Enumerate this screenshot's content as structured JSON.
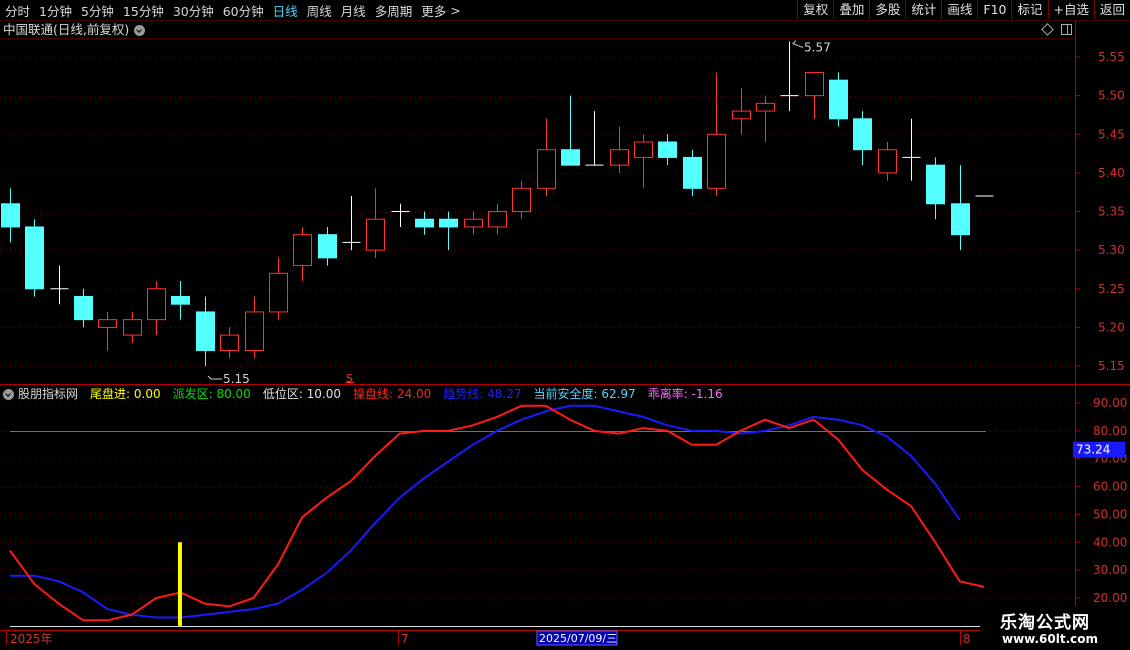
{
  "toolbar": {
    "periods": [
      {
        "label": "分时",
        "active": false
      },
      {
        "label": "1分钟",
        "active": false
      },
      {
        "label": "5分钟",
        "active": false
      },
      {
        "label": "15分钟",
        "active": false
      },
      {
        "label": "30分钟",
        "active": false
      },
      {
        "label": "60分钟",
        "active": false
      },
      {
        "label": "日线",
        "active": true
      },
      {
        "label": "周线",
        "active": false
      },
      {
        "label": "月线",
        "active": false
      },
      {
        "label": "多周期",
        "active": false
      },
      {
        "label": "更多",
        "active": false
      }
    ],
    "more_arrow": ">",
    "right_buttons": [
      "复权",
      "叠加",
      "多股",
      "统计",
      "画线",
      "F10",
      "标记",
      "+自选",
      "返回"
    ]
  },
  "stock_title": "中国联通(日线,前复权)",
  "price_axis": [
    "5.55",
    "5.50",
    "5.45",
    "5.40",
    "5.35",
    "5.30",
    "5.25",
    "5.20",
    "5.15"
  ],
  "annotations": {
    "high": "5.57",
    "low": "5.15",
    "marker": "S"
  },
  "indicator": {
    "name": "股朋指标网",
    "items": [
      {
        "label": "尾盘进: 0.00",
        "color": "#ffff00"
      },
      {
        "label": "派发区: 80.00",
        "color": "#00e000"
      },
      {
        "label": "低位区: 10.00",
        "color": "#e0e0e0"
      },
      {
        "label": "操盘线: 24.00",
        "color": "#ff2020"
      },
      {
        "label": "趋势线: 48.27",
        "color": "#2020ff"
      },
      {
        "label": "当前安全度: 62.97",
        "color": "#4fd3ff"
      },
      {
        "label": "乖离率: -1.16",
        "color": "#ff66ff"
      }
    ],
    "axis": [
      "90.00",
      "80.00",
      "70.00",
      "60.00",
      "50.00",
      "40.00",
      "30.00",
      "20.00"
    ],
    "current_value": "73.24"
  },
  "date_axis": {
    "start": "2025年",
    "m7": "7",
    "cursor": "2025/07/09/三",
    "m8": "8"
  },
  "watermark": {
    "line1": "乐淘公式网",
    "line2": "www.60lt.com"
  },
  "colors": {
    "up": "#ff3232",
    "down": "#54ffff",
    "bg": "#000000",
    "frame": "#b00000"
  },
  "chart_data": {
    "type": "candlestick",
    "price_range": [
      5.14,
      5.57
    ],
    "candles": [
      {
        "o": 5.36,
        "c": 5.33,
        "h": 5.38,
        "l": 5.31
      },
      {
        "o": 5.33,
        "c": 5.25,
        "h": 5.34,
        "l": 5.24
      },
      {
        "o": 5.25,
        "c": 5.25,
        "h": 5.28,
        "l": 5.23
      },
      {
        "o": 5.24,
        "c": 5.21,
        "h": 5.25,
        "l": 5.2
      },
      {
        "o": 5.2,
        "c": 5.21,
        "h": 5.22,
        "l": 5.17
      },
      {
        "o": 5.19,
        "c": 5.21,
        "h": 5.22,
        "l": 5.18
      },
      {
        "o": 5.21,
        "c": 5.25,
        "h": 5.26,
        "l": 5.19
      },
      {
        "o": 5.24,
        "c": 5.23,
        "h": 5.26,
        "l": 5.21
      },
      {
        "o": 5.22,
        "c": 5.17,
        "h": 5.24,
        "l": 5.15
      },
      {
        "o": 5.17,
        "c": 5.19,
        "h": 5.2,
        "l": 5.16
      },
      {
        "o": 5.17,
        "c": 5.22,
        "h": 5.24,
        "l": 5.16
      },
      {
        "o": 5.22,
        "c": 5.27,
        "h": 5.29,
        "l": 5.21
      },
      {
        "o": 5.28,
        "c": 5.32,
        "h": 5.33,
        "l": 5.26
      },
      {
        "o": 5.32,
        "c": 5.29,
        "h": 5.33,
        "l": 5.28
      },
      {
        "o": 5.31,
        "c": 5.31,
        "h": 5.37,
        "l": 5.3
      },
      {
        "o": 5.3,
        "c": 5.34,
        "h": 5.38,
        "l": 5.29
      },
      {
        "o": 5.35,
        "c": 5.35,
        "h": 5.36,
        "l": 5.33
      },
      {
        "o": 5.34,
        "c": 5.33,
        "h": 5.35,
        "l": 5.32
      },
      {
        "o": 5.34,
        "c": 5.33,
        "h": 5.35,
        "l": 5.3
      },
      {
        "o": 5.33,
        "c": 5.34,
        "h": 5.35,
        "l": 5.32
      },
      {
        "o": 5.33,
        "c": 5.35,
        "h": 5.36,
        "l": 5.32
      },
      {
        "o": 5.35,
        "c": 5.38,
        "h": 5.39,
        "l": 5.34
      },
      {
        "o": 5.38,
        "c": 5.43,
        "h": 5.47,
        "l": 5.37
      },
      {
        "o": 5.43,
        "c": 5.41,
        "h": 5.5,
        "l": 5.41
      },
      {
        "o": 5.41,
        "c": 5.41,
        "h": 5.48,
        "l": 5.41
      },
      {
        "o": 5.41,
        "c": 5.43,
        "h": 5.46,
        "l": 5.4
      },
      {
        "o": 5.42,
        "c": 5.44,
        "h": 5.45,
        "l": 5.38
      },
      {
        "o": 5.44,
        "c": 5.42,
        "h": 5.45,
        "l": 5.41
      },
      {
        "o": 5.42,
        "c": 5.38,
        "h": 5.43,
        "l": 5.37
      },
      {
        "o": 5.38,
        "c": 5.45,
        "h": 5.53,
        "l": 5.37
      },
      {
        "o": 5.47,
        "c": 5.48,
        "h": 5.51,
        "l": 5.45
      },
      {
        "o": 5.48,
        "c": 5.49,
        "h": 5.5,
        "l": 5.44
      },
      {
        "o": 5.5,
        "c": 5.5,
        "h": 5.57,
        "l": 5.48
      },
      {
        "o": 5.5,
        "c": 5.53,
        "h": 5.53,
        "l": 5.47
      },
      {
        "o": 5.52,
        "c": 5.47,
        "h": 5.53,
        "l": 5.46
      },
      {
        "o": 5.47,
        "c": 5.43,
        "h": 5.48,
        "l": 5.41
      },
      {
        "o": 5.4,
        "c": 5.43,
        "h": 5.44,
        "l": 5.39
      },
      {
        "o": 5.42,
        "c": 5.42,
        "h": 5.47,
        "l": 5.39
      },
      {
        "o": 5.41,
        "c": 5.36,
        "h": 5.42,
        "l": 5.34
      },
      {
        "o": 5.36,
        "c": 5.32,
        "h": 5.41,
        "l": 5.3
      },
      {
        "o": 5.37,
        "c": 5.37,
        "h": 5.37,
        "l": 5.37
      }
    ],
    "indicator_range": [
      16,
      95
    ],
    "red_line": [
      37,
      25,
      18,
      12,
      12,
      14,
      20,
      22,
      18,
      17,
      20,
      32,
      49,
      56,
      62,
      71,
      79,
      80,
      80,
      82,
      85,
      89,
      89,
      84,
      80,
      79,
      81,
      80,
      75,
      75,
      80,
      84,
      81,
      84,
      77,
      66,
      59,
      53,
      40,
      26,
      24
    ],
    "blue_line": [
      28,
      28,
      26,
      22,
      16,
      14,
      13,
      13,
      14,
      15,
      16,
      18,
      23,
      29,
      37,
      47,
      56,
      63,
      69,
      75,
      80,
      84,
      87,
      89,
      89,
      87,
      85,
      82,
      80,
      80,
      79,
      80,
      82,
      85,
      84,
      82,
      78,
      71,
      61,
      48
    ],
    "yellow_bar": {
      "index": 7,
      "value": 40
    },
    "green_level": 80,
    "white_level": 10
  }
}
